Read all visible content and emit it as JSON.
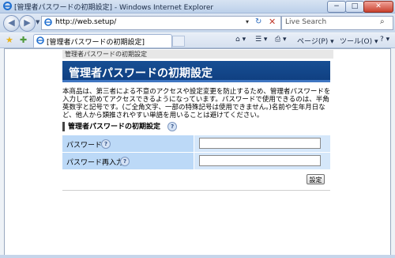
{
  "window": {
    "title": "[管理者パスワードの初期設定] - Windows Internet Explorer",
    "min_label": "−",
    "max_label": "□",
    "close_label": "✕"
  },
  "address_bar": {
    "url": "http://web.setup/",
    "search_placeholder": "Live Search"
  },
  "tab": {
    "label": "[管理者パスワードの初期設定]"
  },
  "command_bar": {
    "home": "⌂ ▾",
    "feeds": "☰ ▾",
    "print": "⎙ ▾",
    "page": "ページ(P) ▾",
    "tools": "ツール(O) ▾",
    "help": "? ▾"
  },
  "page": {
    "breadcrumb": "管理者パスワードの初期設定",
    "title": "管理者パスワードの初期設定",
    "description": "本商品は、第三者による不意のアクセスや設定変更を防止するため、管理者パスワードを入力して初めてアクセスできるようになっています。パスワードで使用できるのは、半角英数字と記号です。(ご全角文字、一部の特殊記号は使用できません。)名前や生年月日など、他人から類推されやすい単語を用いることは避けてください。",
    "section_title": "管理者パスワードの初期設定",
    "help_icon_text": "?",
    "fields": [
      {
        "label": "パスワード",
        "value": ""
      },
      {
        "label": "パスワード再入力",
        "value": ""
      }
    ],
    "submit_label": "設定"
  },
  "colors": {
    "header_bg": "#174f94",
    "label_cell_bg": "#bcd9f7",
    "value_cell_bg": "#d5e7fa"
  }
}
